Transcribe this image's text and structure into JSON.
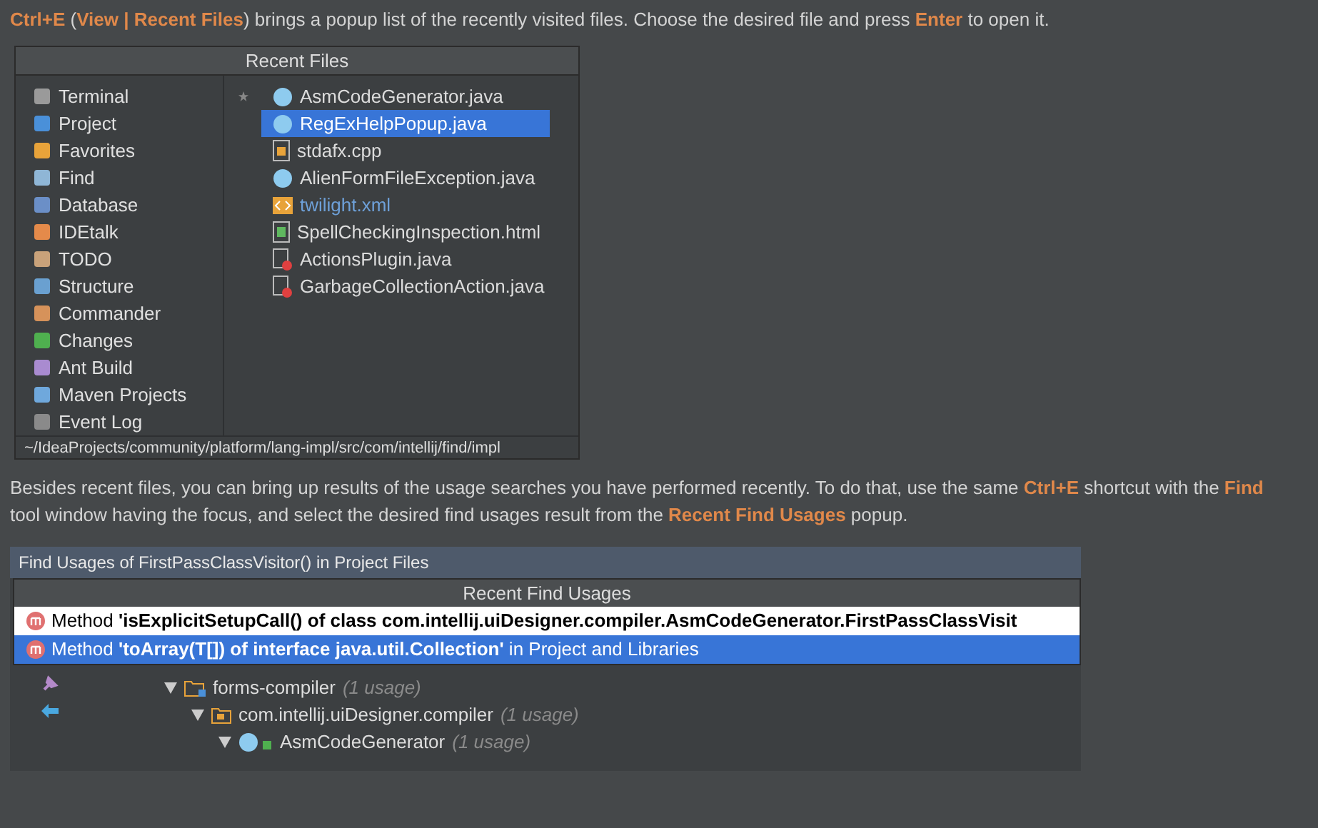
{
  "intro": "**Ctrl+E** (**View | Recent Files**) brings a popup list of the recently visited files. Choose the desired file and press **Enter** to open it.",
  "recent_files": {
    "title": "Recent Files",
    "tool_windows": [
      "Terminal",
      "Project",
      "Favorites",
      "Find",
      "Database",
      "IDEtalk",
      "TODO",
      "Structure",
      "Commander",
      "Changes",
      "Ant Build",
      "Maven Projects",
      "Event Log"
    ],
    "files": [
      {
        "name": "AsmCodeGenerator.java",
        "kind": "class",
        "selected": false,
        "starred": true,
        "modified": false
      },
      {
        "name": "RegExHelpPopup.java",
        "kind": "class",
        "selected": true,
        "starred": false,
        "modified": false
      },
      {
        "name": "stdafx.cpp",
        "kind": "cpp",
        "selected": false,
        "starred": false,
        "modified": false
      },
      {
        "name": "AlienFormFileException.java",
        "kind": "class",
        "selected": false,
        "starred": false,
        "modified": false
      },
      {
        "name": "twilight.xml",
        "kind": "xml",
        "selected": false,
        "starred": false,
        "modified": true
      },
      {
        "name": "SpellCheckingInspection.html",
        "kind": "html",
        "selected": false,
        "starred": false,
        "modified": false
      },
      {
        "name": "ActionsPlugin.java",
        "kind": "error",
        "selected": false,
        "starred": false,
        "modified": false
      },
      {
        "name": "GarbageCollectionAction.java",
        "kind": "error",
        "selected": false,
        "starred": false,
        "modified": false
      }
    ],
    "path": "~/IdeaProjects/community/platform/lang-impl/src/com/intellij/find/impl"
  },
  "body": "Besides recent files, you can bring up results of the usage searches you have performed recently. To do that, use the same **Ctrl+E** shortcut with the **Find** tool window having the focus, and select the desired find usages result from the **Recent Find Usages** popup.",
  "find_panel": {
    "title": "Find Usages of FirstPassClassVisitor() in Project Files",
    "popup_title": "Recent Find Usages",
    "usages": [
      {
        "text": "Method **'isExplicitSetupCall() of class com.intellij.uiDesigner.compiler.AsmCodeGenerator.FirstPassClassVisit**",
        "selected": false
      },
      {
        "text": "Method **'toArray(T[]) of interface java.util.Collection'** in Project and Libraries",
        "selected": true
      }
    ],
    "tree": [
      {
        "label": "forms-compiler",
        "count": "(1 usage)",
        "kind": "module",
        "children": [
          {
            "label": "com.intellij.uiDesigner.compiler",
            "count": "(1 usage)",
            "kind": "package",
            "children": [
              {
                "label": "AsmCodeGenerator",
                "count": "(1 usage)",
                "kind": "class"
              }
            ]
          }
        ]
      }
    ]
  }
}
